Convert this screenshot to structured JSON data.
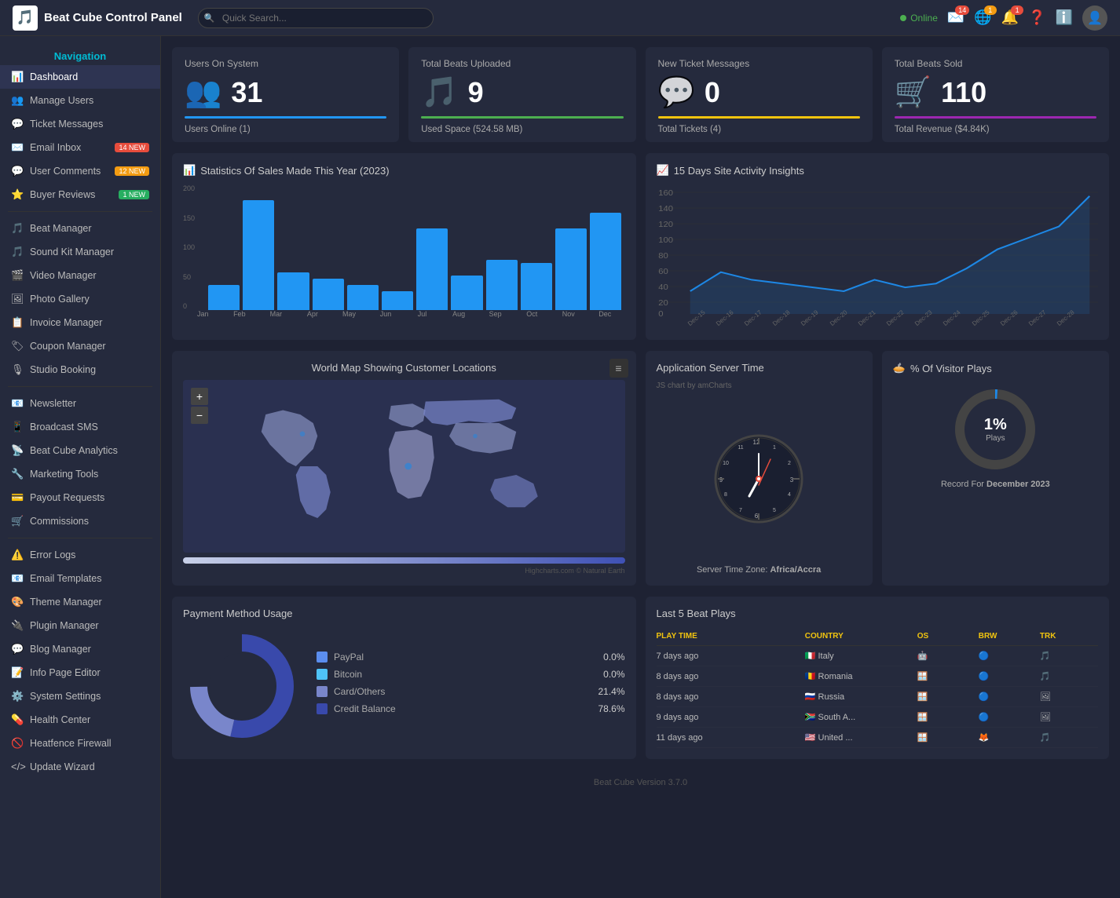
{
  "topbar": {
    "logo_text": "Beat Cube Control Panel",
    "search_placeholder": "Quick Search...",
    "status": "Online",
    "email_badge": "14",
    "globe_badge": "1",
    "bell_badge": "1"
  },
  "sidebar": {
    "nav_title": "Navigation",
    "items": [
      {
        "id": "dashboard",
        "icon": "📊",
        "label": "Dashboard",
        "badge": null
      },
      {
        "id": "manage-users",
        "icon": "👥",
        "label": "Manage Users",
        "badge": null
      },
      {
        "id": "ticket-messages",
        "icon": "💬",
        "label": "Ticket Messages",
        "badge": null
      },
      {
        "id": "email-inbox",
        "icon": "✉️",
        "label": "Email Inbox",
        "badge": "14 NEW",
        "badge_type": "red"
      },
      {
        "id": "user-comments",
        "icon": "💬",
        "label": "User Comments",
        "badge": "12 NEW",
        "badge_type": "orange"
      },
      {
        "id": "buyer-reviews",
        "icon": "⭐",
        "label": "Buyer Reviews",
        "badge": "1 NEW",
        "badge_type": "green"
      },
      {
        "id": "beat-manager",
        "icon": "🎵",
        "label": "Beat Manager",
        "badge": null
      },
      {
        "id": "sound-kit-manager",
        "icon": "🎵",
        "label": "Sound Kit Manager",
        "badge": null
      },
      {
        "id": "video-manager",
        "icon": "🎬",
        "label": "Video Manager",
        "badge": null
      },
      {
        "id": "photo-gallery",
        "icon": "🖼",
        "label": "Photo Gallery",
        "badge": null
      },
      {
        "id": "invoice-manager",
        "icon": "📋",
        "label": "Invoice Manager",
        "badge": null
      },
      {
        "id": "coupon-manager",
        "icon": "🏷",
        "label": "Coupon Manager",
        "badge": null
      },
      {
        "id": "studio-booking",
        "icon": "🎙",
        "label": "Studio Booking",
        "badge": null
      },
      {
        "id": "newsletter",
        "icon": "📧",
        "label": "Newsletter",
        "badge": null
      },
      {
        "id": "broadcast-sms",
        "icon": "📱",
        "label": "Broadcast SMS",
        "badge": null
      },
      {
        "id": "beat-cube-analytics",
        "icon": "📡",
        "label": "Beat Cube Analytics",
        "badge": null
      },
      {
        "id": "marketing-tools",
        "icon": "🔧",
        "label": "Marketing Tools",
        "badge": null
      },
      {
        "id": "payout-requests",
        "icon": "💳",
        "label": "Payout Requests",
        "badge": null
      },
      {
        "id": "commissions",
        "icon": "🛒",
        "label": "Commissions",
        "badge": null
      },
      {
        "id": "error-logs",
        "icon": "⚠️",
        "label": "Error Logs",
        "badge": null
      },
      {
        "id": "email-templates",
        "icon": "📧",
        "label": "Email Templates",
        "badge": null
      },
      {
        "id": "theme-manager",
        "icon": "🎨",
        "label": "Theme Manager",
        "badge": null
      },
      {
        "id": "plugin-manager",
        "icon": "🔌",
        "label": "Plugin Manager",
        "badge": null
      },
      {
        "id": "blog-manager",
        "icon": "💬",
        "label": "Blog Manager",
        "badge": null
      },
      {
        "id": "info-page-editor",
        "icon": "📝",
        "label": "Info Page Editor",
        "badge": null
      },
      {
        "id": "system-settings",
        "icon": "⚙️",
        "label": "System Settings",
        "badge": null
      },
      {
        "id": "health-center",
        "icon": "💊",
        "label": "Health Center",
        "badge": null
      },
      {
        "id": "heatfence-firewall",
        "icon": "🚫",
        "label": "Heatfence Firewall",
        "badge": null
      },
      {
        "id": "update-wizard",
        "icon": "</>",
        "label": "Update Wizard",
        "badge": null
      }
    ]
  },
  "stats": [
    {
      "title": "Users On System",
      "icon": "👥",
      "value": "31",
      "line": "blue",
      "sub": "Users Online (1)"
    },
    {
      "title": "Total Beats Uploaded",
      "icon": "🎵",
      "value": "9",
      "line": "green",
      "sub": "Used Space (524.58 MB)"
    },
    {
      "title": "New Ticket Messages",
      "icon": "💬",
      "value": "0",
      "line": "yellow",
      "sub": "Total Tickets (4)"
    },
    {
      "title": "Total Beats Sold",
      "icon": "🛒",
      "value": "110",
      "line": "purple",
      "sub": "Total Revenue ($4.84K)"
    }
  ],
  "sales_chart": {
    "title": "Statistics Of Sales Made This Year (2023)",
    "months": [
      "Jan",
      "Feb",
      "Mar",
      "Apr",
      "May",
      "Jun",
      "Jul",
      "Aug",
      "Sep",
      "Oct",
      "Nov",
      "Dec"
    ],
    "values": [
      40,
      175,
      60,
      50,
      40,
      30,
      130,
      55,
      80,
      75,
      130,
      155
    ],
    "max": 200,
    "y_labels": [
      "200",
      "150",
      "100",
      "50",
      "0"
    ]
  },
  "activity_chart": {
    "title": "15 Days Site Activity Insights",
    "max": 160,
    "y_labels": [
      "160",
      "140",
      "120",
      "100",
      "80",
      "60",
      "40",
      "20",
      "0"
    ],
    "dates": [
      "Dec-15",
      "Dec-16",
      "Dec-17",
      "Dec-18",
      "Dec-19",
      "Dec-20",
      "Dec-21",
      "Dec-22",
      "Dec-23",
      "Dec-24",
      "Dec-25",
      "Dec-26",
      "Dec-27",
      "Dec-28"
    ],
    "values": [
      30,
      55,
      45,
      40,
      35,
      30,
      45,
      35,
      40,
      60,
      85,
      100,
      115,
      155
    ]
  },
  "map": {
    "title": "World Map Showing Customer Locations",
    "credit": "Highcharts.com © Natural Earth"
  },
  "server_time": {
    "title": "Application Server Time",
    "subtitle": "JS chart by amCharts",
    "timezone_label": "Server Time Zone:",
    "timezone": "Africa/Accra"
  },
  "visitor_plays": {
    "title": "% Of Visitor Plays",
    "percent": "1%",
    "sub": "Plays",
    "record_label": "Record For",
    "record_period": "December 2023"
  },
  "payment": {
    "title": "Payment Method Usage",
    "items": [
      {
        "label": "PayPal",
        "value": "0.0%",
        "color": "#5b8dee"
      },
      {
        "label": "Bitcoin",
        "value": "0.0%",
        "color": "#4fc3f7"
      },
      {
        "label": "Card/Others",
        "value": "21.4%",
        "color": "#7986cb"
      },
      {
        "label": "Credit Balance",
        "value": "78.6%",
        "color": "#3949ab"
      }
    ]
  },
  "beat_plays": {
    "title": "Last 5 Beat Plays",
    "headers": [
      "PLAY TIME",
      "COUNTRY",
      "OS",
      "BRW",
      "TRK"
    ],
    "rows": [
      {
        "time": "7 days ago",
        "country": "Italy",
        "flag": "🇮🇹",
        "os": "Android",
        "browser": "Chrome",
        "trk": "🎵"
      },
      {
        "time": "8 days ago",
        "country": "Romania",
        "flag": "🇷🇴",
        "os": "Windows",
        "browser": "Chrome",
        "trk": "🎵"
      },
      {
        "time": "8 days ago",
        "country": "Russia",
        "flag": "🇷🇺",
        "os": "Windows",
        "browser": "Chrome",
        "trk": "🖼"
      },
      {
        "time": "9 days ago",
        "country": "South A...",
        "flag": "🇿🇦",
        "os": "Windows",
        "browser": "Chrome",
        "trk": "🖼"
      },
      {
        "time": "11 days ago",
        "country": "United ...",
        "flag": "🇺🇸",
        "os": "Windows",
        "browser": "Firefox",
        "trk": "🎵"
      }
    ]
  },
  "footer": {
    "text": "Beat Cube Version 3.7.0"
  }
}
